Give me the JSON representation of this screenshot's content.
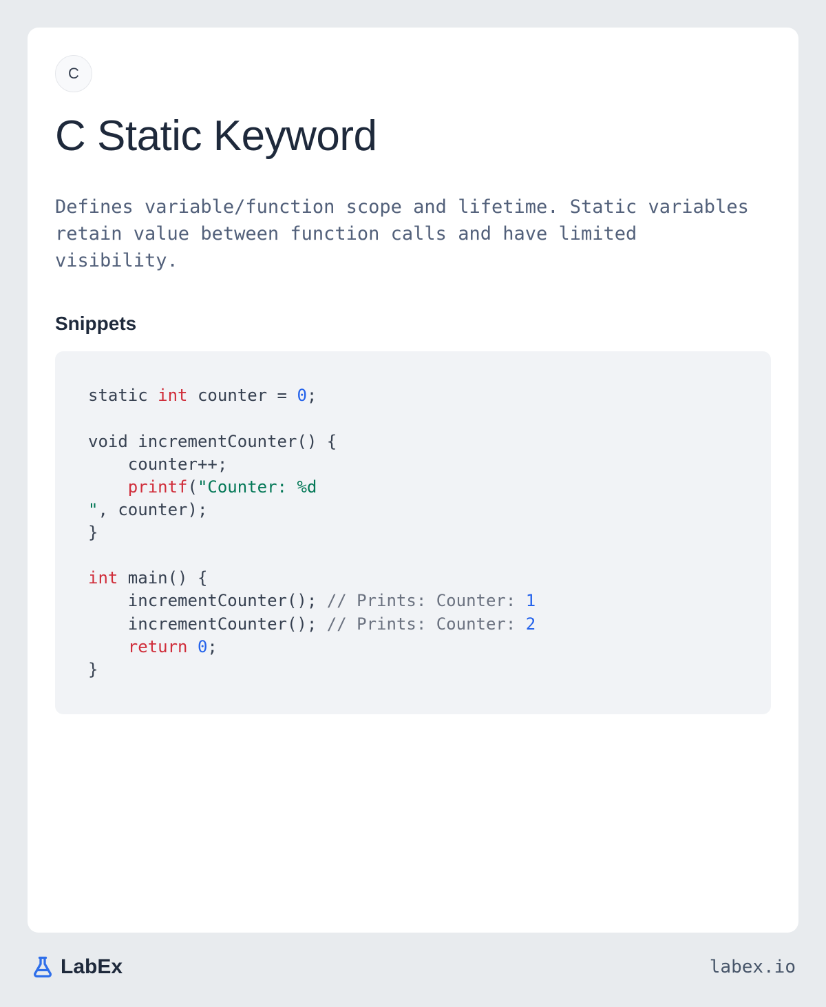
{
  "lang_badge": "C",
  "title": "C Static Keyword",
  "description": "Defines variable/function scope and lifetime. Static variables retain value between function calls and have limited visibility.",
  "snippets_heading": "Snippets",
  "brand_name": "LabEx",
  "site_url": "labex.io",
  "colors": {
    "page_bg": "#e8ebee",
    "card_bg": "#ffffff",
    "code_bg": "#f1f3f6",
    "text_primary": "#1e293b",
    "text_secondary": "#52607a",
    "syntax_type": "#d02d3a",
    "syntax_number": "#2563eb",
    "syntax_string": "#047857",
    "syntax_comment": "#6b7280",
    "brand_blue": "#2f6fea"
  },
  "code": {
    "tokens": [
      {
        "t": "static ",
        "c": "plain"
      },
      {
        "t": "int",
        "c": "type"
      },
      {
        "t": " counter = ",
        "c": "plain"
      },
      {
        "t": "0",
        "c": "num"
      },
      {
        "t": ";\n\nvoid incrementCounter() {\n    counter++;\n    ",
        "c": "plain"
      },
      {
        "t": "printf",
        "c": "type"
      },
      {
        "t": "(",
        "c": "plain"
      },
      {
        "t": "\"Counter: %d\n\"",
        "c": "str"
      },
      {
        "t": ", counter);\n}\n\n",
        "c": "plain"
      },
      {
        "t": "int",
        "c": "type"
      },
      {
        "t": " main() {\n    incrementCounter(); ",
        "c": "plain"
      },
      {
        "t": "// Prints: Counter: ",
        "c": "cmt"
      },
      {
        "t": "1",
        "c": "num"
      },
      {
        "t": "\n    incrementCounter(); ",
        "c": "plain"
      },
      {
        "t": "// Prints: Counter: ",
        "c": "cmt"
      },
      {
        "t": "2",
        "c": "num"
      },
      {
        "t": "\n    ",
        "c": "plain"
      },
      {
        "t": "return",
        "c": "type"
      },
      {
        "t": " ",
        "c": "plain"
      },
      {
        "t": "0",
        "c": "num"
      },
      {
        "t": ";\n}",
        "c": "plain"
      }
    ]
  }
}
